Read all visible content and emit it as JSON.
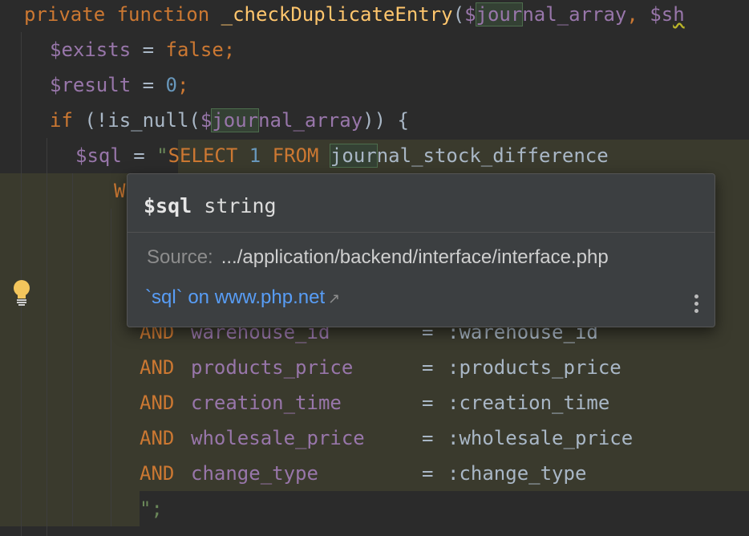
{
  "code": {
    "line1": {
      "kw": "private function ",
      "fn": "_checkDuplicateEntry",
      "open": "(",
      "var_prefix": "$",
      "var_hl": "jour",
      "var_rest": "nal_array",
      "sep": ", ",
      "var2_prefix": "$s",
      "var2_squiggle": "h"
    },
    "line2": {
      "var": "$exists",
      "op": " = ",
      "val": "false",
      "end": ";"
    },
    "line3": {
      "var": "$result",
      "op": " = ",
      "num": "0",
      "end": ";"
    },
    "line4": {
      "kw": "if",
      "pre": " (!is_null(",
      "var_prefix": "$",
      "var_hl": "jour",
      "var_rest": "nal_array",
      "post": ")) {"
    },
    "line5": {
      "var": "$sql",
      "op": " = ",
      "quote": "\"",
      "sql": "SELECT ",
      "num": "1",
      "from": " FROM ",
      "table_hl": "jour",
      "table_rest": "nal_stock_difference"
    },
    "line6_partial": "W",
    "and_rows": [
      {
        "kw": "AND",
        "col": "warehouse_id",
        "eq": "=",
        "param": ":warehouse_id"
      },
      {
        "kw": "AND",
        "col": "products_price",
        "eq": "=",
        "param": ":products_price"
      },
      {
        "kw": "AND",
        "col": "creation_time",
        "eq": "=",
        "param": ":creation_time"
      },
      {
        "kw": "AND",
        "col": "wholesale_price",
        "eq": "=",
        "param": ":wholesale_price"
      },
      {
        "kw": "AND",
        "col": "change_type",
        "eq": "=",
        "param": ":change_type"
      }
    ],
    "closing": "\";"
  },
  "popup": {
    "name": "$sql",
    "type": "string",
    "source_label": "Source:",
    "source_path": ".../application/backend/interface/interface.php",
    "link_text": "`sql` on www.php.net",
    "link_arrow": "↗"
  },
  "icons": {
    "intention": "lightbulb-icon",
    "more": "more-vertical-icon",
    "external": "external-link-icon"
  },
  "colors": {
    "background": "#2b2b2b",
    "keyword": "#cc7832",
    "function": "#ffc66d",
    "variable": "#9876aa",
    "number": "#6897bb",
    "popup_bg": "#3c3f41",
    "link": "#589df6"
  }
}
